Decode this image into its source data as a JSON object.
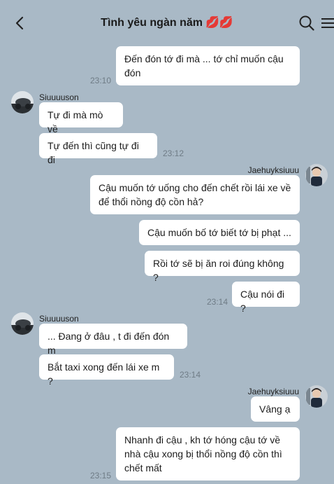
{
  "header": {
    "title": "Tình yêu ngàn năm",
    "title_emoji": "💋💋",
    "back_icon": "chevron-left-icon",
    "search_icon": "search-icon",
    "menu_icon": "hamburger-menu-icon"
  },
  "messages": [
    {
      "text": "Đến đón tớ đi mà ... tớ chỉ muốn cậu\nđón",
      "time": "23:10"
    },
    {
      "sender": "Siuuuuson"
    },
    {
      "text": "Tự đi mà mò về"
    },
    {
      "text": "Tự đến thì cũng tự đi đi",
      "time": "23:12"
    },
    {
      "sender": "Jaehuyksiuuu"
    },
    {
      "text": "Cậu muốn tớ uống cho đến chết rồi lái xe về\nđể thổi nồng độ cồn hả?"
    },
    {
      "text": "Cậu muốn bố tớ biết tớ bị phạt ..."
    },
    {
      "text": "Rồi tớ sẽ bị ăn roi đúng không ?"
    },
    {
      "text": "Cậu nói đi ?",
      "time": "23:14"
    },
    {
      "sender": "Siuuuuson"
    },
    {
      "text": "... Đang ở đâu , t đi đến đón m"
    },
    {
      "text": "Bắt taxi xong đến lái xe m ?",
      "time": "23:14"
    },
    {
      "sender": "Jaehuyksiuuu"
    },
    {
      "text": "Vâng ạ"
    },
    {
      "text": "Nhanh đi cậu , kh tớ hóng cậu tớ về\nnhà cậu xong bị thổi nồng độ cồn thì\nchết mất",
      "time": "23:15"
    }
  ]
}
